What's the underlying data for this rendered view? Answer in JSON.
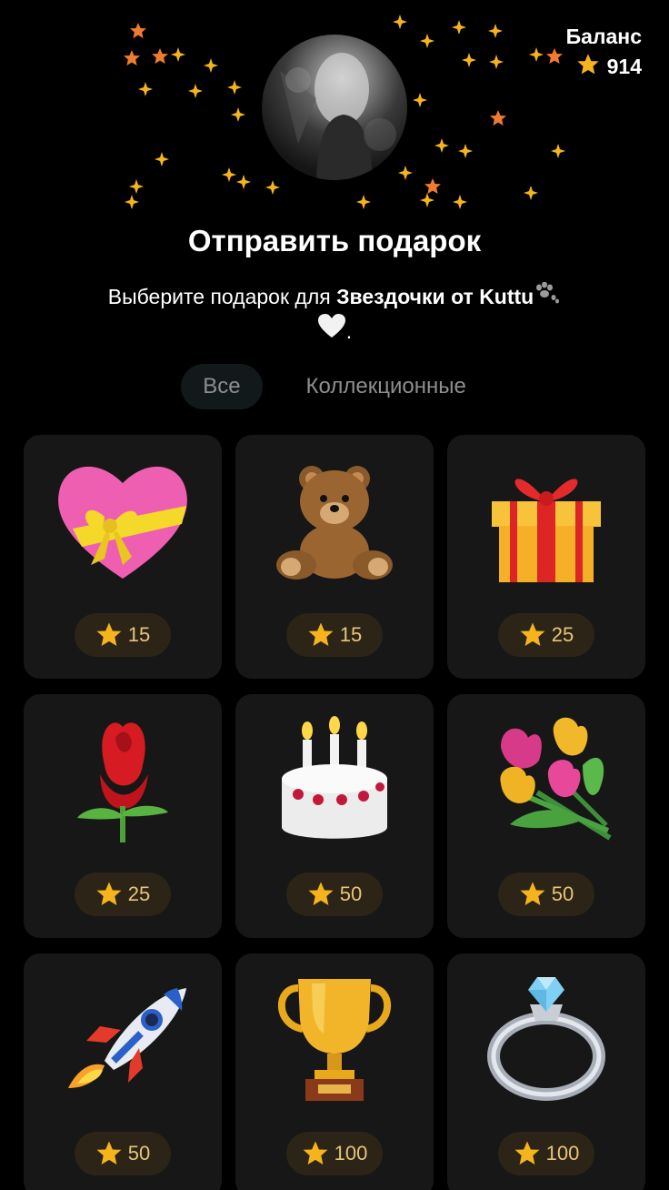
{
  "header": {
    "balance_label": "Баланс",
    "balance_value": "914"
  },
  "title": "Отправить подарок",
  "subtitle": {
    "prefix": "Выберите подарок для ",
    "recipient": "Звездочки от Kuttu",
    "suffix": "."
  },
  "tabs": [
    {
      "label": "Все",
      "active": true
    },
    {
      "label": "Коллекционные",
      "active": false
    }
  ],
  "gifts": [
    {
      "name": "heart-with-ribbon",
      "price": "15"
    },
    {
      "name": "teddy-bear",
      "price": "15"
    },
    {
      "name": "gift-box",
      "price": "25"
    },
    {
      "name": "rose",
      "price": "25"
    },
    {
      "name": "birthday-cake",
      "price": "50"
    },
    {
      "name": "tulip-bouquet",
      "price": "50"
    },
    {
      "name": "rocket",
      "price": "50"
    },
    {
      "name": "trophy",
      "price": "100"
    },
    {
      "name": "diamond-ring",
      "price": "100"
    }
  ],
  "colors": {
    "background": "#000000",
    "card": "#171717",
    "price_pill": "#2c2416",
    "star": "#f5b41c",
    "accent_star": "#f07a2e"
  }
}
